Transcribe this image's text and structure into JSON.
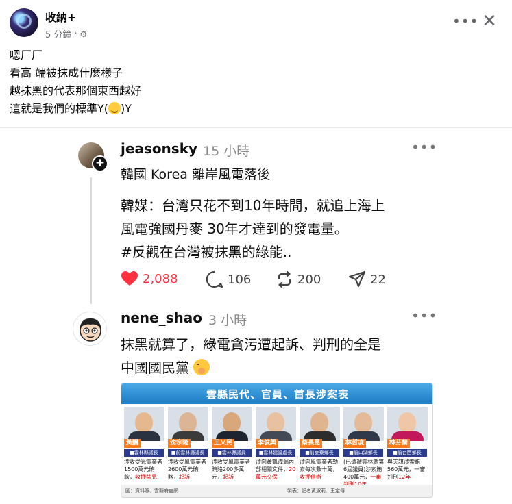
{
  "post": {
    "author": "收納+",
    "time": "5 分鐘",
    "lines": [
      "嗯厂厂",
      "看高 端被抹成什麼樣子",
      "越抹黑的代表那個東西越好"
    ],
    "last_line_prefix": "這就是我們的標準Y(",
    "last_line_suffix": ")Y"
  },
  "thread": {
    "first": {
      "username": "jeasonsky",
      "time": "15 小時",
      "lines": [
        "韓國 Korea 離岸風電落後",
        "韓媒：台灣只花不到10年時間，就追上海上",
        "風電強國丹麥 30年才達到的發電量。",
        "#反觀在台灣被抹黑的綠能.."
      ],
      "likes": "2,088",
      "replies": "106",
      "reposts": "200",
      "shares": "22"
    },
    "second": {
      "username": "nene_shao",
      "time": "3 小時",
      "lines": [
        "抹黑就算了，綠電貪污遭起訴、判刑的全是",
        "中國國民黨"
      ]
    }
  },
  "news": {
    "title": "雲縣民代、官員、首長涉案表",
    "people": [
      {
        "name": "黃飄",
        "title": "■雲林縣議長",
        "desc": "涉收受光電業者1500萬元賄款，",
        "status": "收押禁見"
      },
      {
        "name": "沈宗隆",
        "title": "■前雲林縣議長",
        "desc": "涉收受風電業者2600萬元賄賂，",
        "status": "起訴"
      },
      {
        "name": "王乂民",
        "title": "■雲林縣議員",
        "desc": "涉收受風電業者賄賂200多萬元，",
        "status": "起訴"
      },
      {
        "name": "李俊興",
        "title": "■雲林建設處長",
        "desc": "涉向黃凱洩漏內部相關文件，",
        "status": "20萬元交保"
      },
      {
        "name": "蔡長昆",
        "title": "■前麥寮鄉長",
        "desc": "涉向風電業者勒索每次數十萬，",
        "status": "收押偵辦"
      },
      {
        "name": "林哲凌",
        "title": "■前口湖鄉長",
        "desc": "(已遭褫雲林縣第6屆議員)涉索賄400萬元，",
        "status": "一審判刑10年"
      },
      {
        "name": "林芬蘭",
        "title": "■前台西鄉長",
        "desc": "與夫謀涉索賄560萬元，一審判刑",
        "status": "12年"
      }
    ],
    "source": "圖：資料照、雲縣府官網",
    "credit": "製表：記者黃淑莉、王定傳"
  },
  "colors": {
    "like": "#ff3040",
    "band": "#1c7cc4",
    "name_tag": "#ff7a1a",
    "title_tag": "#2a3b8f"
  },
  "icons": [
    "gear-icon",
    "more-icon",
    "close-icon",
    "heart-icon",
    "comment-icon",
    "repost-icon",
    "share-icon"
  ]
}
